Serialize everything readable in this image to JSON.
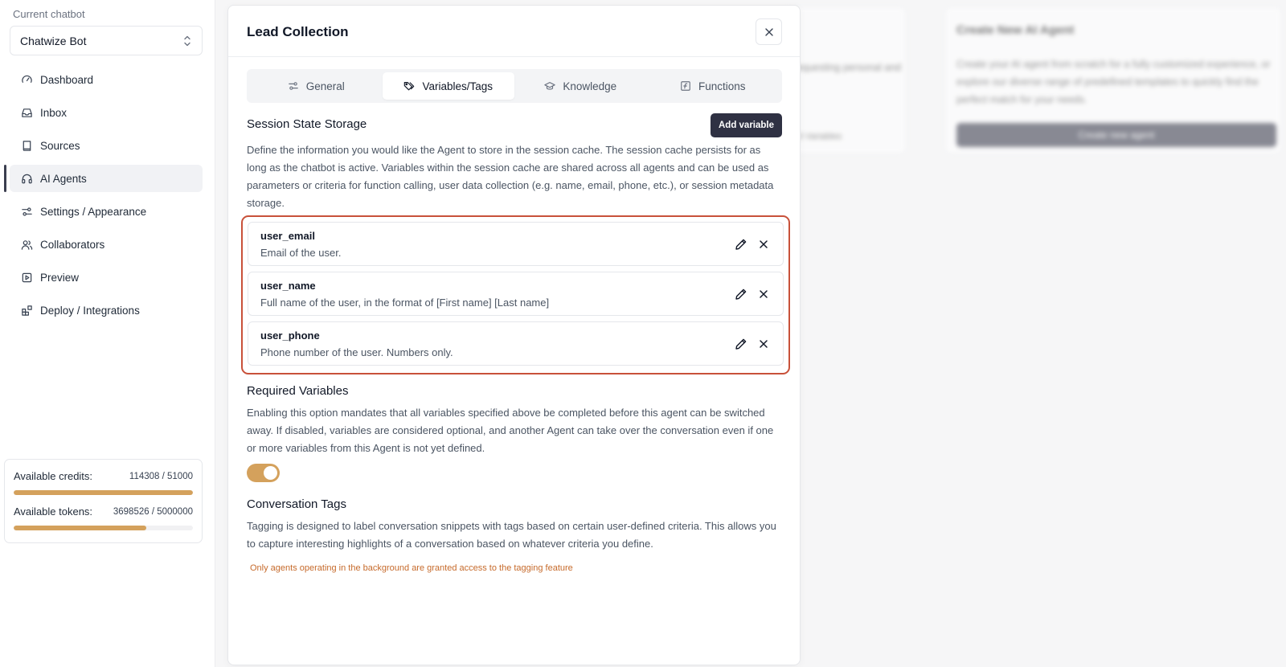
{
  "sidebar": {
    "current_chatbot_label": "Current chatbot",
    "chatbot_name": "Chatwize Bot",
    "nav": [
      {
        "label": "Dashboard",
        "icon": "gauge-icon"
      },
      {
        "label": "Inbox",
        "icon": "inbox-icon"
      },
      {
        "label": "Sources",
        "icon": "book-icon"
      },
      {
        "label": "AI Agents",
        "icon": "headset-icon",
        "active": true
      },
      {
        "label": "Settings / Appearance",
        "icon": "sliders-icon"
      },
      {
        "label": "Collaborators",
        "icon": "users-icon"
      },
      {
        "label": "Preview",
        "icon": "play-square-icon"
      },
      {
        "label": "Deploy / Integrations",
        "icon": "blocks-icon"
      }
    ],
    "credits": {
      "label": "Available credits:",
      "value": "114308 / 51000",
      "fill_ratio": 1.0
    },
    "tokens": {
      "label": "Available tokens:",
      "value": "3698526 / 5000000",
      "fill_ratio": 0.7397
    },
    "accent_color": "#d4a15c"
  },
  "background": {
    "card1_text": "requesting personal and",
    "card1_meta": "3 Variables",
    "card2_title": "Create New AI Agent",
    "card2_desc": "Create your AI agent from scratch for a fully customized experience, or explore our diverse range of predefined templates to quickly find the perfect match for your needs.",
    "card2_button": "Create new agent"
  },
  "modal": {
    "title": "Lead Collection",
    "tabs": [
      {
        "label": "General",
        "icon": "sliders-icon"
      },
      {
        "label": "Variables/Tags",
        "icon": "tags-icon",
        "active": true
      },
      {
        "label": "Knowledge",
        "icon": "graduation-cap-icon"
      },
      {
        "label": "Functions",
        "icon": "function-square-icon"
      }
    ],
    "session": {
      "title": "Session State Storage",
      "add_button": "Add variable",
      "description": "Define the information you would like the Agent to store in the session cache. The session cache persists for as long as the chatbot is active. Variables within the session cache are shared across all agents and can be used as parameters or criteria for function calling, user data collection (e.g. name, email, phone, etc.), or session metadata storage."
    },
    "variables": [
      {
        "name": "user_email",
        "description": "Email of the user."
      },
      {
        "name": "user_name",
        "description": "Full name of the user, in the format of [First name] [Last name]"
      },
      {
        "name": "user_phone",
        "description": "Phone number of the user. Numbers only."
      }
    ],
    "required": {
      "title": "Required Variables",
      "description": "Enabling this option mandates that all variables specified above be completed before this agent can be switched away. If disabled, variables are considered optional, and another Agent can take over the conversation even if one or more variables from this Agent is not yet defined.",
      "enabled": true
    },
    "tags": {
      "title": "Conversation Tags",
      "description": "Tagging is designed to label conversation snippets with tags based on certain user-defined criteria. This allows you to capture interesting highlights of a conversation based on whatever criteria you define.",
      "warning": "Only agents operating in the background are granted access to the tagging feature"
    },
    "highlight_color": "#c8513a"
  }
}
